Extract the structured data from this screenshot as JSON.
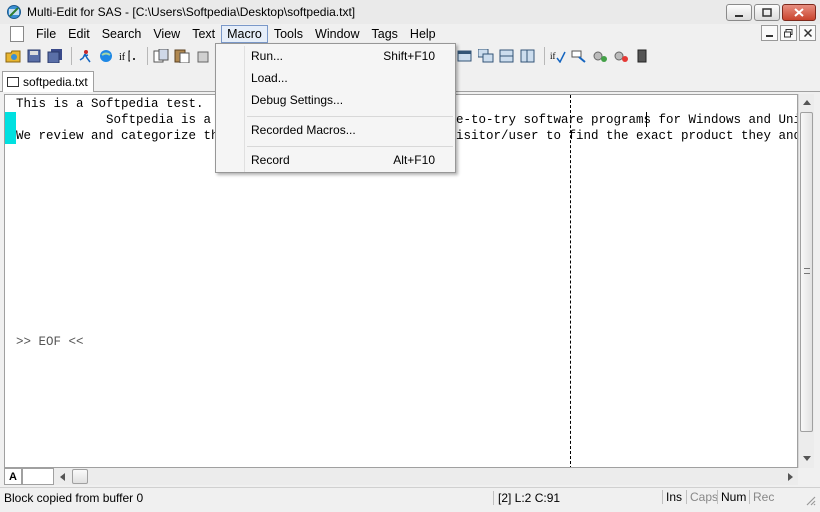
{
  "window": {
    "title": "Multi-Edit for SAS - [C:\\Users\\Softpedia\\Desktop\\softpedia.txt]",
    "controls": [
      "minimize",
      "restore",
      "close"
    ]
  },
  "menu": {
    "items": [
      "File",
      "Edit",
      "Search",
      "View",
      "Text",
      "Macro",
      "Tools",
      "Window",
      "Tags",
      "Help"
    ],
    "active": "Macro"
  },
  "macro_menu": {
    "run_label": "Run...",
    "run_shortcut": "Shift+F10",
    "load_label": "Load...",
    "debug_label": "Debug Settings...",
    "recorded_label": "Recorded Macros...",
    "record_label": "Record",
    "record_shortcut": "Alt+F10"
  },
  "tab": {
    "filename": "softpedia.txt"
  },
  "editor": {
    "line1": "This is a Softpedia test.",
    "line2_left": "            Softpedia is a li",
    "line2_right": "e-to-try software programs for Windows and Unix/",
    "line3_left": "We review and categorize thes",
    "line3_right": "isitor/user to find the exact product they and th",
    "eof": ">> EOF <<"
  },
  "bottom": {
    "column_label": "A"
  },
  "status": {
    "message": "Block copied from buffer 0",
    "position": "[2] L:2 C:91",
    "ins": "Ins",
    "caps": "Caps",
    "num": "Num",
    "rec": "Rec"
  },
  "colors": {
    "gutter_mark": "#00e0e0",
    "menu_highlight": "#e6eef9"
  }
}
